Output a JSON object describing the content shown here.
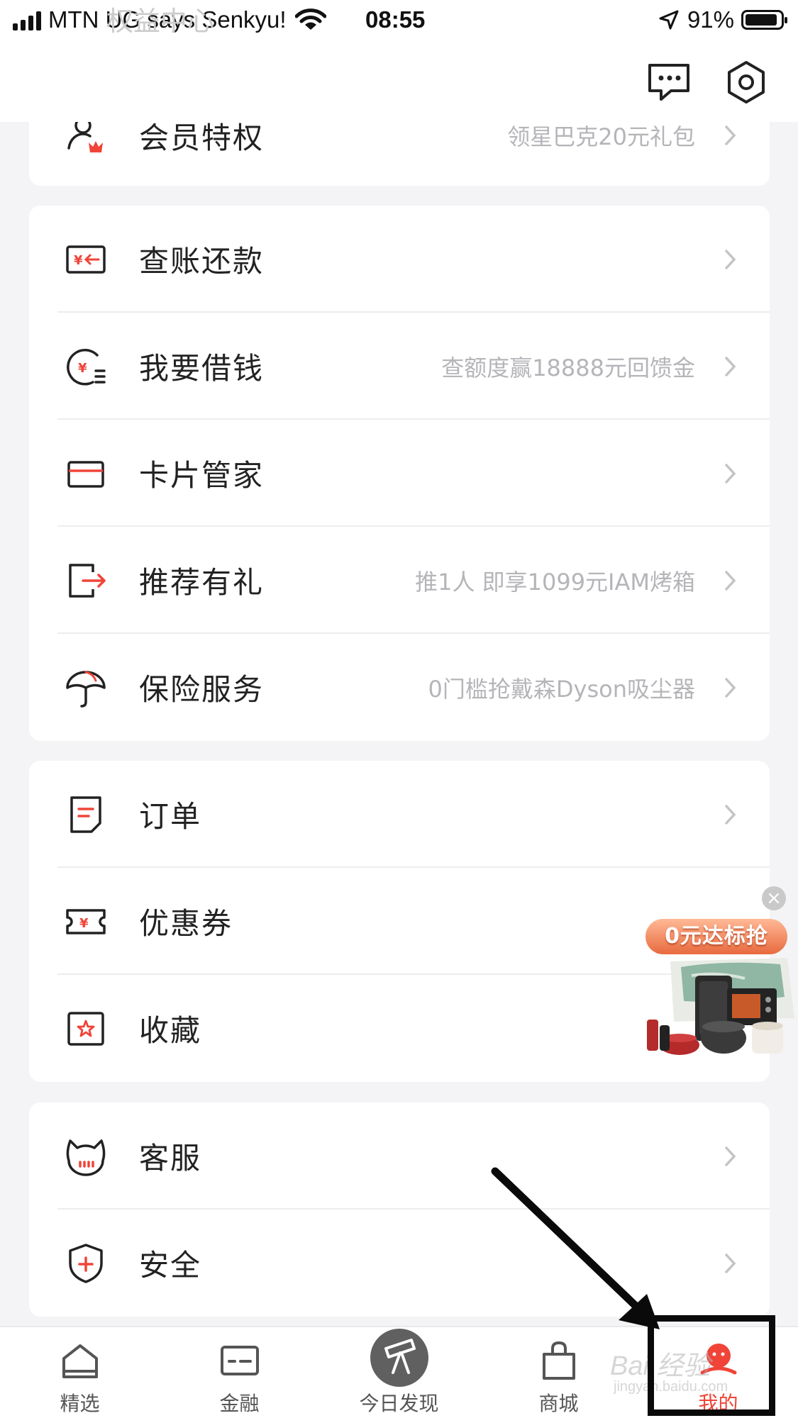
{
  "status_bar": {
    "carrier": "MTN UG says Senkyu!",
    "time": "08:55",
    "battery": "91%",
    "battery_level": 0.91
  },
  "ghost_header": "权益中心",
  "top_bar": {
    "icons": [
      "message-icon",
      "settings-icon"
    ],
    "has_unread": true
  },
  "card_member": {
    "title": "会员特权",
    "sub": "领星巴克20元礼包"
  },
  "card_finance": [
    {
      "title": "查账还款",
      "sub": "",
      "icon": "bill-icon"
    },
    {
      "title": "我要借钱",
      "sub": "查额度赢18888元回馈金",
      "icon": "loan-icon"
    },
    {
      "title": "卡片管家",
      "sub": "",
      "icon": "card-icon"
    },
    {
      "title": "推荐有礼",
      "sub": "推1人 即享1099元IAM烤箱",
      "icon": "share-icon"
    },
    {
      "title": "保险服务",
      "sub": "0门槛抢戴森Dyson吸尘器",
      "icon": "umbrella-icon"
    }
  ],
  "card_orders": [
    {
      "title": "订单",
      "icon": "order-icon"
    },
    {
      "title": "优惠券",
      "icon": "coupon-icon"
    },
    {
      "title": "收藏",
      "icon": "favorite-icon"
    }
  ],
  "card_service": [
    {
      "title": "客服",
      "icon": "service-icon"
    },
    {
      "title": "安全",
      "icon": "security-icon"
    }
  ],
  "ad": {
    "banner": "0元达标抢",
    "close": "×"
  },
  "tabs": [
    {
      "label": "精选",
      "icon": "home-icon"
    },
    {
      "label": "金融",
      "icon": "finance-icon"
    },
    {
      "label": "今日发现",
      "icon": "telescope-icon"
    },
    {
      "label": "商城",
      "icon": "shop-bag-icon"
    },
    {
      "label": "我的",
      "icon": "mine-icon",
      "active": true
    }
  ],
  "watermark": {
    "text": "Bai 经验",
    "url": "jingyan.baidu.com"
  },
  "colors": {
    "accent": "#f04438",
    "text": "#222222",
    "sub_text": "#b5b5b9",
    "background": "#f4f4f6"
  }
}
